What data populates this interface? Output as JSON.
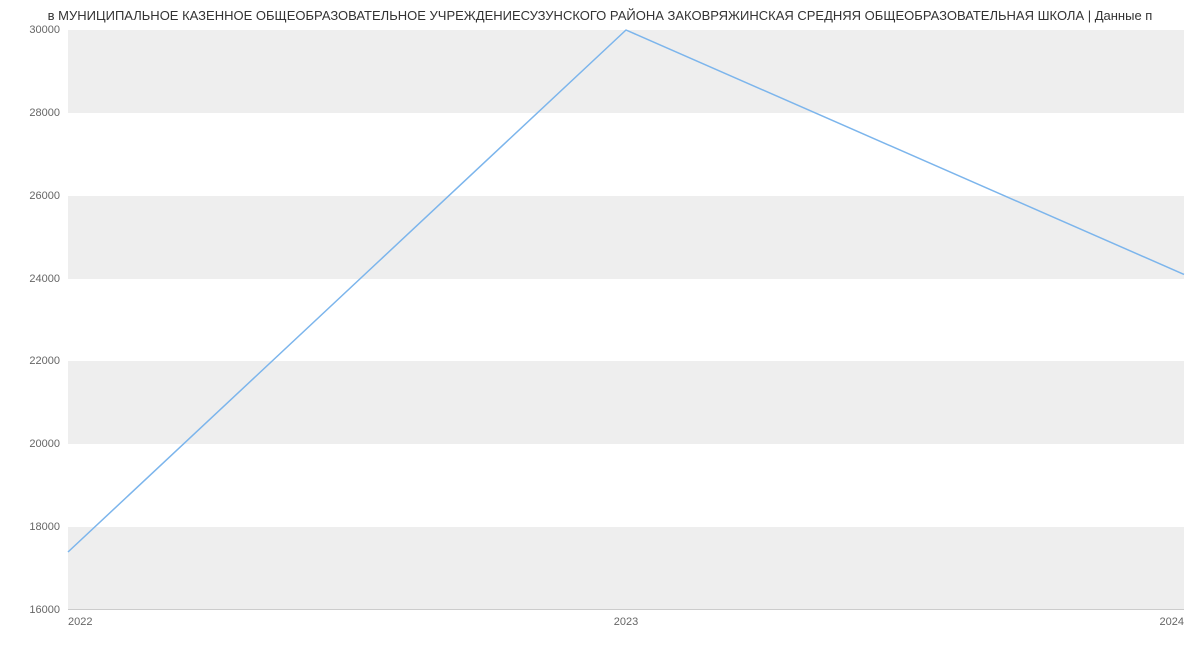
{
  "chart_data": {
    "type": "line",
    "title": "в МУНИЦИПАЛЬНОЕ КАЗЕННОЕ ОБЩЕОБРАЗОВАТЕЛЬНОЕ УЧРЕЖДЕНИЕСУЗУНСКОГО РАЙОНА ЗАКОВРЯЖИНСКАЯ СРЕДНЯЯ ОБЩЕОБРАЗОВАТЕЛЬНАЯ ШКОЛА | Данные п",
    "x": [
      2022,
      2023,
      2024
    ],
    "values": [
      17400,
      30000,
      24100
    ],
    "xlabel": "",
    "ylabel": "",
    "ylim": [
      16000,
      30000
    ],
    "xlim": [
      2022,
      2024
    ],
    "y_ticks": [
      16000,
      18000,
      20000,
      22000,
      24000,
      26000,
      28000,
      30000
    ],
    "x_ticks": [
      2022,
      2023,
      2024
    ],
    "line_color": "#7cb5ec",
    "bands": [
      [
        16000,
        18000
      ],
      [
        20000,
        22000
      ],
      [
        24000,
        26000
      ],
      [
        28000,
        30000
      ]
    ]
  }
}
